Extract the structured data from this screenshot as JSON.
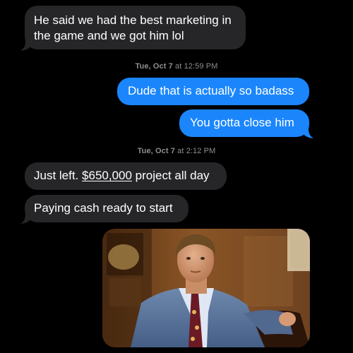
{
  "conversation": {
    "messages": [
      {
        "direction": "incoming",
        "text_line1": "He said we had the best marketing in",
        "text_line2": "the game and we got him lol"
      },
      {
        "direction": "outgoing",
        "text": "Dude that is actually so badass"
      },
      {
        "direction": "outgoing",
        "text": "You gotta close him"
      },
      {
        "direction": "incoming",
        "text_before": "Just left. ",
        "link_text": "$650,000",
        "text_after": " project all day"
      },
      {
        "direction": "incoming",
        "text": "Paying cash ready to start"
      }
    ],
    "timestamps": [
      {
        "day": "Tue, Oct 7",
        "sep": " at ",
        "time": "12:59 PM"
      },
      {
        "day": "Tue, Oct 7",
        "sep": " at ",
        "time": "2:12 PM"
      }
    ]
  },
  "colors": {
    "background": "#000000",
    "incoming_bubble": "#262629",
    "outgoing_bubble": "#1b86fc",
    "timestamp_text": "#8e8e93"
  },
  "attachment": {
    "type": "image",
    "icon": "photo-attachment"
  }
}
